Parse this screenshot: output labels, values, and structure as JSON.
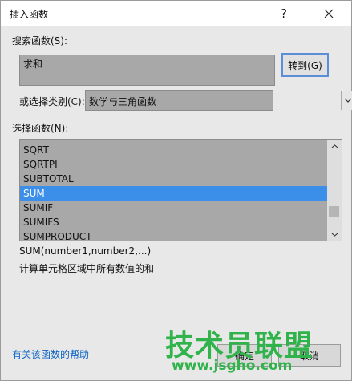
{
  "dialog": {
    "title": "插入函数",
    "help_glyph": "?",
    "search_label": "搜索函数(S):",
    "search_value": "求和",
    "goto_label": "转到(G)",
    "category_label": "或选择类别(C):",
    "category_value": "数学与三角函数",
    "function_label": "选择函数(N):",
    "functions": [
      "SQRT",
      "SQRTPI",
      "SUBTOTAL",
      "SUM",
      "SUMIF",
      "SUMIFS",
      "SUMPRODUCT"
    ],
    "selected_function": "SUM",
    "syntax": "SUM(number1,number2,...)",
    "description": "计算单元格区域中所有数值的和",
    "help_link": "有关该函数的帮助",
    "ok_label": "确定",
    "cancel_label": "取消"
  },
  "watermark": {
    "logo": "技术员联盟",
    "url": "www.jsgho.com"
  },
  "colors": {
    "selection": "#3c8fe8",
    "link": "#0b63c4",
    "watermark": "#2fb34a"
  }
}
